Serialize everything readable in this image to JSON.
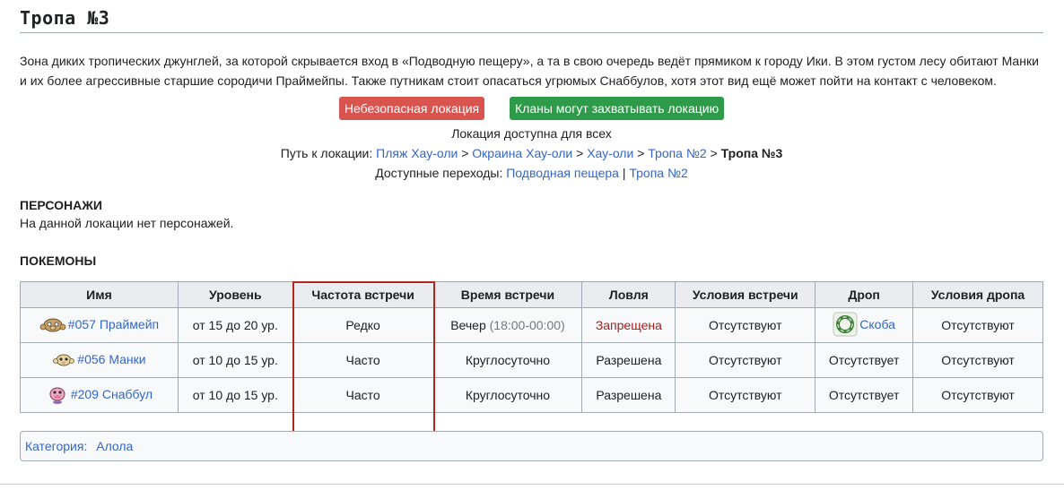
{
  "page": {
    "title": "Тропа №3",
    "description": "Зона диких тропических джунглей, за которой скрывается вход в «Подводную пещеру», а та в свою очередь ведёт прямиком к городу Ики. В этом густом лесу обитают Манки и их более агрессивные старшие сородичи Праймейпы. Также путникам стоит опасаться угрюмых Снаббулов, хотя этот вид ещё может пойти на контакт с человеком."
  },
  "badges": {
    "unsafe": "Небезопасная локация",
    "clans": "Кланы могут захватывать локацию",
    "unsafe_color": "#d9534f",
    "clans_color": "#2e9b4b"
  },
  "access": "Локация доступна для всех",
  "path": {
    "label": "Путь к локации:",
    "sep": ">",
    "links": [
      "Пляж Хау-оли",
      "Окраина Хау-оли",
      "Хау-оли",
      "Тропа №2"
    ],
    "current": "Тропа №3"
  },
  "transitions": {
    "label": "Доступные переходы:",
    "sep": "|",
    "links": [
      "Подводная пещера",
      "Тропа №2"
    ]
  },
  "characters": {
    "title": "ПЕРСОНАЖИ",
    "text": "На данной локации нет персонажей."
  },
  "pokemon": {
    "title": "ПОКЕМОНЫ",
    "headers": [
      "Имя",
      "Уровень",
      "Частота встречи",
      "Время встречи",
      "Ловля",
      "Условия встречи",
      "Дроп",
      "Условия дропа"
    ],
    "rows": [
      {
        "name": "#057 Праймейп",
        "icon": "primeape-sprite-icon",
        "level": "от 15 до 20 ур.",
        "frequency": "Редко",
        "time": "Вечер",
        "time_note": "(18:00-00:00)",
        "catch": "Запрещена",
        "conditions": "Отсутствуют",
        "drop": "Скоба",
        "drop_icon": "bracket-item-icon",
        "drop_conditions": "Отсутствуют"
      },
      {
        "name": "#056 Манки",
        "icon": "mankey-sprite-icon",
        "level": "от 10 до 15 ур.",
        "frequency": "Часто",
        "time": "Круглосуточно",
        "time_note": "",
        "catch": "Разрешена",
        "conditions": "Отсутствуют",
        "drop": "Отсутствует",
        "drop_icon": "",
        "drop_conditions": "Отсутствуют"
      },
      {
        "name": "#209 Снаббул",
        "icon": "snubbull-sprite-icon",
        "level": "от 10 до 15 ур.",
        "frequency": "Часто",
        "time": "Круглосуточно",
        "time_note": "",
        "catch": "Разрешена",
        "conditions": "Отсутствуют",
        "drop": "Отсутствует",
        "drop_icon": "",
        "drop_conditions": "Отсутствуют"
      }
    ]
  },
  "category": {
    "label": "Категория:",
    "link": "Алола"
  },
  "colors": {
    "link": "#3366cc",
    "forbidden": "#a32020",
    "highlight": "#b3261e"
  }
}
